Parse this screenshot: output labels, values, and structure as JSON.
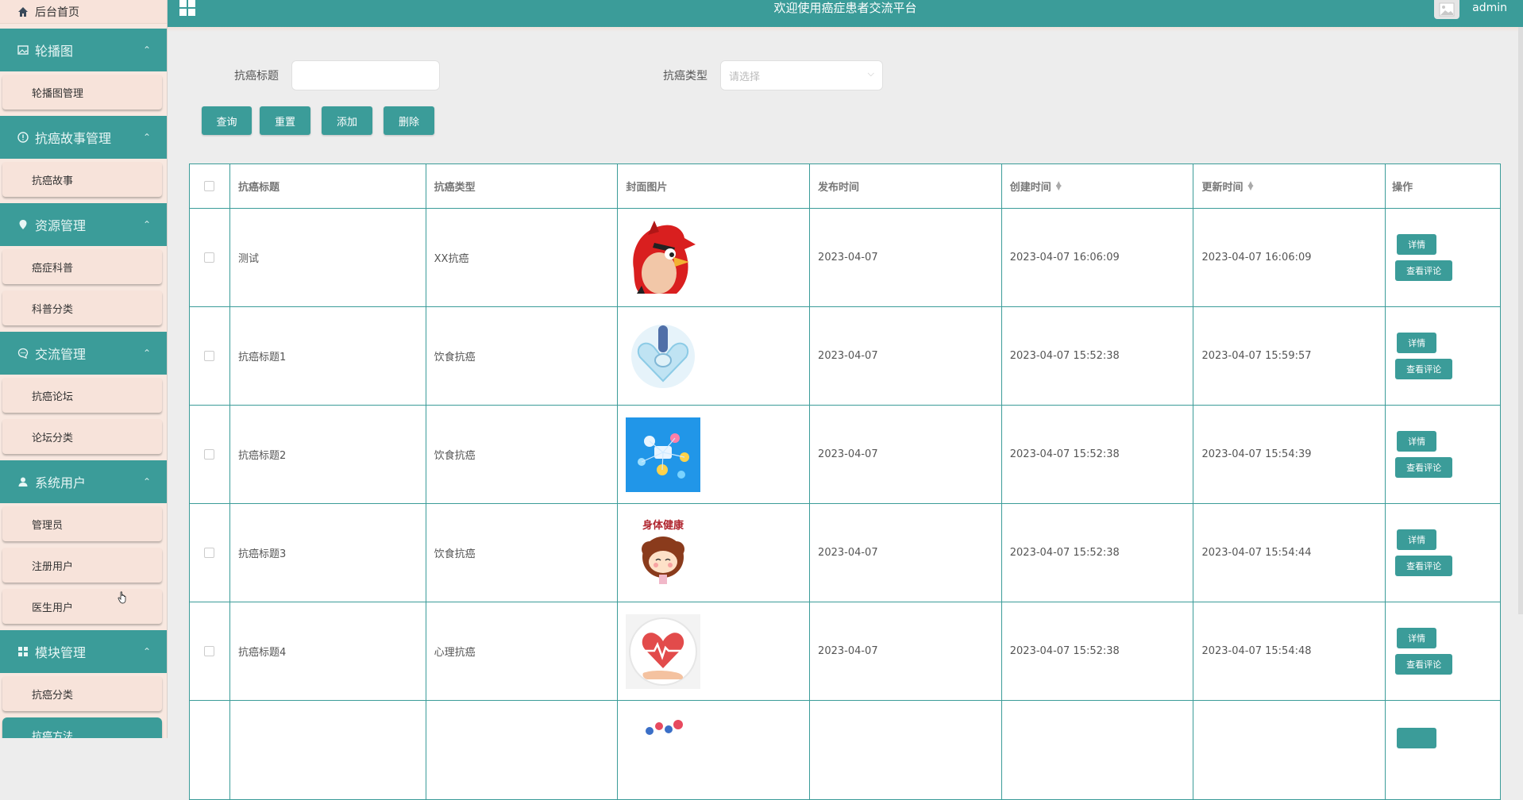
{
  "sidebar": {
    "home": "后台首页",
    "groups": [
      {
        "title": "轮播图",
        "icon": "image-icon",
        "items": [
          "轮播图管理"
        ]
      },
      {
        "title": "抗癌故事管理",
        "icon": "info-circle-icon",
        "items": [
          "抗癌故事"
        ]
      },
      {
        "title": "资源管理",
        "icon": "location-pin-icon",
        "items": [
          "癌症科普",
          "科普分类"
        ]
      },
      {
        "title": "交流管理",
        "icon": "chat-bubble-icon",
        "items": [
          "抗癌论坛",
          "论坛分类"
        ]
      },
      {
        "title": "系统用户",
        "icon": "user-icon",
        "items": [
          "管理员",
          "注册用户",
          "医生用户"
        ]
      },
      {
        "title": "模块管理",
        "icon": "grid-icon",
        "items": [
          "抗癌分类",
          "抗癌方法"
        ]
      }
    ]
  },
  "header": {
    "title": "欢迎使用癌症患者交流平台",
    "user": "admin"
  },
  "search": {
    "title_label": "抗癌标题",
    "title_value": "",
    "type_label": "抗癌类型",
    "type_placeholder": "请选择",
    "buttons": {
      "query": "查询",
      "reset": "重置",
      "add": "添加",
      "delete": "删除"
    }
  },
  "table": {
    "columns": [
      "抗癌标题",
      "抗癌类型",
      "封面图片",
      "发布时间",
      "创建时间",
      "更新时间",
      "操作"
    ],
    "detail_label": "详情",
    "comment_label": "查看评论",
    "rows": [
      {
        "title": "测试",
        "type": "XX抗癌",
        "image": "angry-bird-image",
        "publish": "2023-04-07",
        "created": "2023-04-07 16:06:09",
        "updated": "2023-04-07 16:06:09"
      },
      {
        "title": "抗癌标题1",
        "type": "饮食抗癌",
        "image": "heart-hands-organ-image",
        "publish": "2023-04-07",
        "created": "2023-04-07 15:52:38",
        "updated": "2023-04-07 15:59:57"
      },
      {
        "title": "抗癌标题2",
        "type": "饮食抗癌",
        "image": "health-icons-blue-image",
        "publish": "2023-04-07",
        "created": "2023-04-07 15:52:38",
        "updated": "2023-04-07 15:54:39"
      },
      {
        "title": "抗癌标题3",
        "type": "饮食抗癌",
        "image": "cartoon-girl-image",
        "image_text": "身体健康",
        "publish": "2023-04-07",
        "created": "2023-04-07 15:52:38",
        "updated": "2023-04-07 15:54:44"
      },
      {
        "title": "抗癌标题4",
        "type": "心理抗癌",
        "image": "heart-in-hand-image",
        "publish": "2023-04-07",
        "created": "2023-04-07 15:52:38",
        "updated": "2023-04-07 15:54:48"
      }
    ]
  },
  "colors": {
    "accent": "#3b9c99",
    "sidebar_bg": "#f8e8e0",
    "page_bg": "#ededed"
  }
}
